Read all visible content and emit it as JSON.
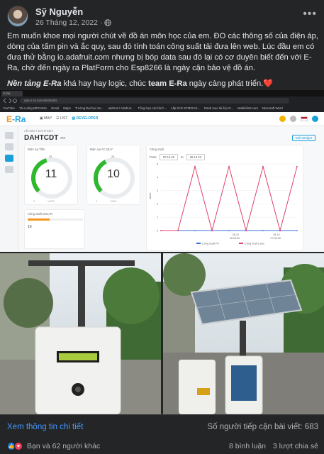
{
  "post": {
    "author": "Sỹ Nguyễn",
    "date": "26 Tháng 12, 2022",
    "more_icon": "ellipsis-icon",
    "paragraph1": "Em muốn khoe mọi người chút về đồ án môn học của em. ĐO các thông số của điện áp, dòng của tấm pin và ắc quy, sau đó tính toán công suất tải đưa lên web. Lúc đầu em có đưa thử bằng io.adafruit.com nhưng bị bóp data sau đó lại có cơ duyên biết đến với E-Ra, chờ đến ngày ra PlatForm cho Esp8266 là ngày cận bảo vệ đồ án.",
    "paragraph2_part1": "Nền tảng E-Ra",
    "paragraph2_part2": " khá hay hay logic, chúc ",
    "paragraph2_part3": "team E-Ra",
    "paragraph2_part4": " ngày càng phát triển.",
    "heart": "❤️"
  },
  "dashboard": {
    "logo_e": "E",
    "logo_ra": "-Ra",
    "nav": [
      "MAP",
      "LIST",
      "DEVELOPER"
    ],
    "breadcrumb": "All units  /  DAHTCDT",
    "title": "DAHTCDT",
    "edit_widget": "Edit Widget",
    "url": "app.e-ra.io/units/details",
    "bookmarks": [
      "YouTube",
      "Tài xuống MP3-M4A",
      "Gmail",
      "Maps",
      "Trường Đại học Sư...",
      "adafruit / Adafruit...",
      "Tổng hợp các bài h...",
      "Lắp trình STM32 từ...",
      "Danh mục tài liệu D...",
      "Mobilefirst.com",
      "Microsoft Word"
    ],
    "tab_label": "E-RA",
    "gauges": [
      {
        "title": "Điện Áp Tấm",
        "value": "11",
        "unit": "VOLT",
        "min": "0",
        "max": "25",
        "fraction": 0.44,
        "color": "#2eb82e"
      },
      {
        "title": "Điện Áp ÁC QUY",
        "value": "10",
        "unit": "VOLT",
        "min": "0",
        "max": "25",
        "fraction": 0.4,
        "color": "#2eb82e"
      }
    ],
    "small_card": {
      "title": "Công Suất SOLAR",
      "value": "10",
      "fraction": 0.4
    },
    "chart_card": {
      "title": "Công Suất",
      "from_label": "From",
      "from_value": "20.12.22",
      "to_label": "to",
      "to_value": "26.12.22"
    }
  },
  "chart_data": {
    "type": "line",
    "title": "Công Suất",
    "ylabel": "Value",
    "x_ticks": [
      "26.12 16:00:00",
      "26.12 17:00:00"
    ],
    "y_ticks": [
      "0",
      "1",
      "2",
      "3",
      "4",
      "5"
    ],
    "ylim": [
      0,
      5
    ],
    "series": [
      {
        "name": "Công Suất PV",
        "color": "#3b6fd8",
        "values": [
          0,
          0,
          0,
          0,
          0,
          0,
          0,
          0,
          0
        ]
      },
      {
        "name": "Công Suất Load",
        "color": "#e0406b",
        "values": [
          0,
          0,
          4.8,
          0,
          4.8,
          0,
          4.8,
          0,
          4.8
        ]
      }
    ]
  },
  "footer": {
    "see_more": "Xem thông tin chi tiết",
    "reach": "Số người tiếp cận bài viết: 683",
    "reactors": "Bạn và 62 người khác",
    "comments": "8 bình luận",
    "shares": "3 lượt chia sẻ"
  },
  "colors": {
    "accent": "#4599ff",
    "era_blue": "#2da5e0",
    "era_orange": "#f7941d",
    "like": "#1877f2",
    "love": "#f33e58"
  }
}
